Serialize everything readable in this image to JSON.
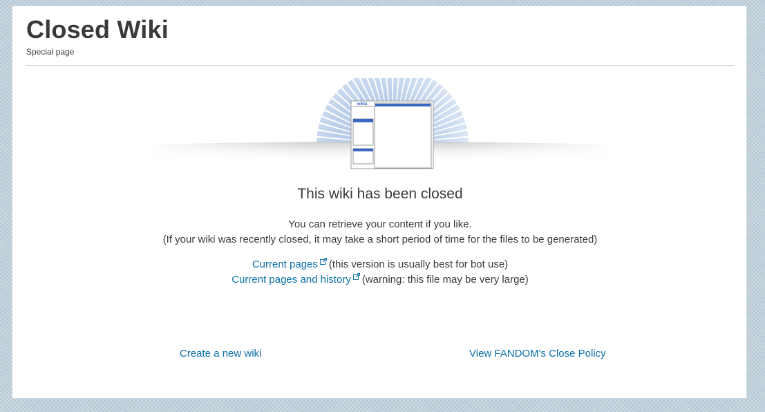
{
  "header": {
    "title": "Closed Wiki",
    "subtitle": "Special page"
  },
  "hero": {
    "logo_text": "wikia",
    "icon": "closed-wiki-illustration"
  },
  "main": {
    "heading": "This wiki has been closed",
    "info_line_1": "You can retrieve your content if you like.",
    "info_line_2": "(If your wiki was recently closed, it may take a short period of time for the files to be generated)"
  },
  "downloads": [
    {
      "label": "Current pages",
      "note": "(this version is usually best for bot use)",
      "icon": "external-link-icon"
    },
    {
      "label": "Current pages and history",
      "note": "(warning: this file may be very large)",
      "icon": "external-link-icon"
    }
  ],
  "footer": {
    "create_label": "Create a new wiki",
    "policy_label": "View FANDOM's Close Policy"
  },
  "colors": {
    "link": "#0b6fa8",
    "text": "#3a3a3a",
    "accent_blue": "#3a66c4",
    "background": "#b7c9d5"
  }
}
